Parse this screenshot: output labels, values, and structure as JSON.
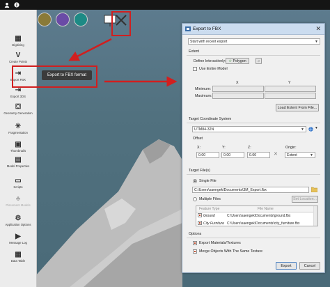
{
  "sidebar": {
    "items": [
      {
        "label": "Digitizing",
        "icon": "digitizing-icon",
        "glyph": "▦",
        "dim": false
      },
      {
        "label": "Create Points",
        "icon": "create-points-icon",
        "glyph": "V",
        "dim": false
      },
      {
        "label": "Export FBX",
        "icon": "export-fbx-icon",
        "glyph": "⇥",
        "dim": false
      },
      {
        "label": "Export 3DS",
        "icon": "export-3ds-icon",
        "glyph": "⇥",
        "dim": false
      },
      {
        "label": "Geometry Generation",
        "icon": "geometry-generation-icon",
        "glyph": "⛋",
        "dim": false
      },
      {
        "label": "Fragmentation",
        "icon": "fragmentation-icon",
        "glyph": "✳",
        "dim": false
      },
      {
        "label": "Thumbnails",
        "icon": "thumbnails-icon",
        "glyph": "▣",
        "dim": false
      },
      {
        "label": "Model Properties",
        "icon": "model-properties-icon",
        "glyph": "▤",
        "dim": false
      },
      {
        "label": "Scripts",
        "icon": "scripts-icon",
        "glyph": "▭",
        "dim": false
      },
      {
        "label": "Placement Models",
        "icon": "placement-models-icon",
        "glyph": "♣",
        "dim": true
      },
      {
        "label": "Application Options",
        "icon": "application-options-icon",
        "glyph": "⚙",
        "dim": false
      },
      {
        "label": "Message Log",
        "icon": "message-log-icon",
        "glyph": "▶",
        "dim": false
      },
      {
        "label": "Data Table",
        "icon": "data-table-icon",
        "glyph": "▦",
        "dim": false
      }
    ]
  },
  "tooltip": "Export to FBX format",
  "colors": {
    "accent_red": "#d11f1f",
    "tool_orange": "#e36a2b",
    "tool_olive": "#8a7a38",
    "tool_purple": "#6a4ba6",
    "tool_teal": "#1d8a85",
    "dialog_title": "#cbdcef"
  },
  "dialog": {
    "title": "Export to FBX",
    "close": "✕",
    "start_combo": "Start with recent export",
    "extent": {
      "section": "Extent",
      "define_label": "Define Interactively:",
      "polygon_button": "Polygon",
      "use_entire_model": "Use Entire Model",
      "x_header": "X",
      "y_header": "Y",
      "minimum": "Minimum:",
      "maximum": "Maximum:",
      "load_button": "Load Extent From File..."
    },
    "tcs": {
      "section": "Target Coordinate System",
      "value": "UTM84-32N",
      "offset_label": "Offset",
      "x_label": "X:",
      "y_label": "Y:",
      "z_label": "Z:",
      "x_value": "0.00",
      "y_value": "0.00",
      "z_value": "0.00",
      "origin_label": "Origin:",
      "origin_value": "Extent"
    },
    "files": {
      "section": "Target File(s)",
      "single_label": "Single File",
      "single_path": "C:\\Users\\saengek\\Documents\\3M_Export.fbx",
      "multiple_label": "Multiple Files",
      "set_location": "Set Location...",
      "col_feature_type": "Feature Type",
      "col_file_name": "File Name",
      "rows": [
        {
          "feature": "Ground",
          "file": "C:\\Users\\saengek\\Documents\\ground.fbx"
        },
        {
          "feature": "City Furniture",
          "file": "C:\\Users\\saengek\\Documents\\city_furniture.fbx"
        }
      ]
    },
    "options": {
      "section": "Options",
      "export_materials": "Export Materials/Textures",
      "merge_objects": "Merge Objects With The Same Texture"
    },
    "buttons": {
      "export": "Export",
      "cancel": "Cancel"
    }
  }
}
